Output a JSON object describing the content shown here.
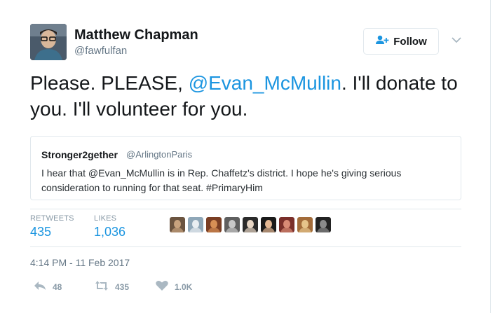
{
  "author": {
    "name": "Matthew Chapman",
    "handle": "@fawfulfan"
  },
  "follow_button": {
    "label": "Follow"
  },
  "tweet": {
    "text_before": "Please. PLEASE, ",
    "mention": "@Evan_McMullin",
    "text_after": ". I'll donate to you. I'll volunteer for you."
  },
  "quoted_tweet": {
    "name": "Stronger2gether",
    "handle": "@ArlingtonParis",
    "text": "I hear that @Evan_McMullin is in Rep. Chaffetz's district. I hope he's giving serious consideration to running for that seat. #PrimaryHim"
  },
  "stats": {
    "retweets_label": "RETWEETS",
    "retweets_value": "435",
    "likes_label": "LIKES",
    "likes_value": "1,036"
  },
  "likers": [
    {
      "color_a": "#6b5440",
      "color_b": "#c7a27e"
    },
    {
      "color_a": "#8fa7b8",
      "color_b": "#e9eef2"
    },
    {
      "color_a": "#7a3e24",
      "color_b": "#d78f55"
    },
    {
      "color_a": "#5f5f5f",
      "color_b": "#c8c8c8"
    },
    {
      "color_a": "#2b2b2b",
      "color_b": "#e7d6c5"
    },
    {
      "color_a": "#1a1a1a",
      "color_b": "#e4b894"
    },
    {
      "color_a": "#7a2f2a",
      "color_b": "#d98a75"
    },
    {
      "color_a": "#a36c3a",
      "color_b": "#e6c48a"
    },
    {
      "color_a": "#222222",
      "color_b": "#8a8a8a"
    }
  ],
  "timestamp": "4:14 PM - 11 Feb 2017",
  "actions": {
    "reply_count": "48",
    "retweet_count": "435",
    "like_count": "1.0K"
  },
  "colors": {
    "link": "#1b95e0",
    "muted": "#657786",
    "border": "#e1e8ed"
  },
  "icons": [
    "follow-user-icon",
    "chevron-down-icon",
    "reply-icon",
    "retweet-icon",
    "heart-icon"
  ]
}
